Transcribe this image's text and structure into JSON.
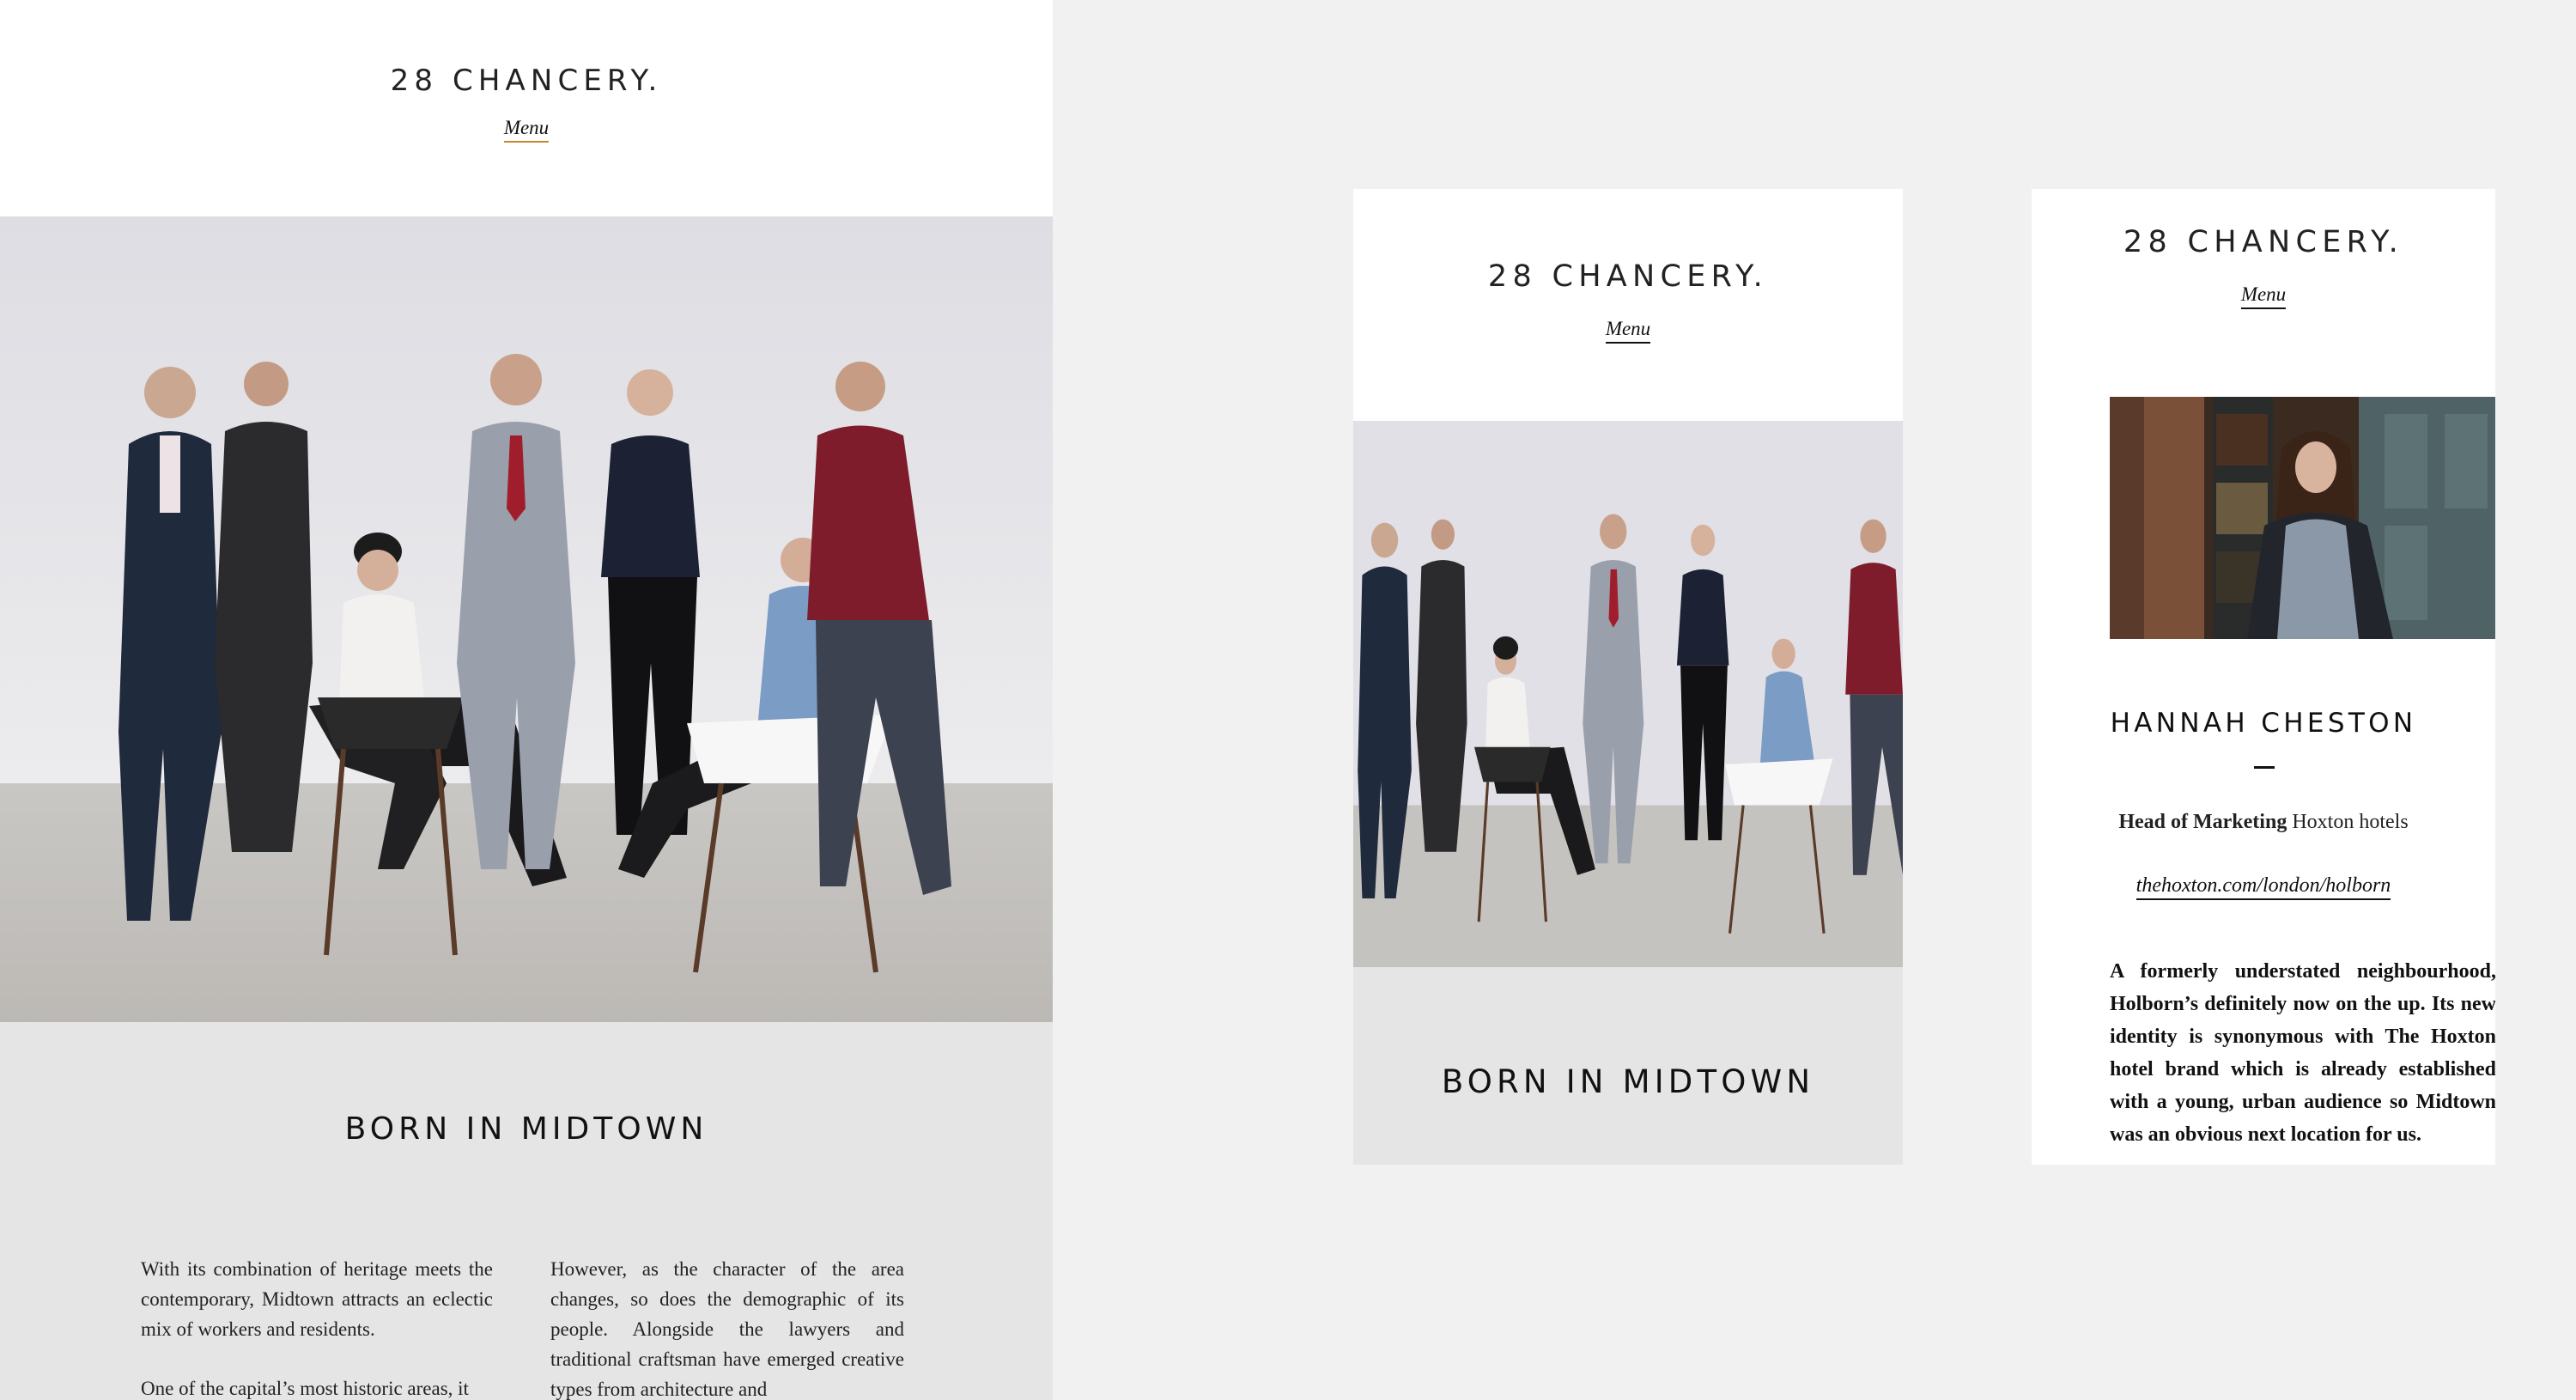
{
  "site": {
    "logo": "28 CHANCERY.",
    "menu_label": "Menu"
  },
  "colors": {
    "page_bg": "#f1f1f1",
    "panel_bg": "#ffffff",
    "article_bg": "#e5e5e5",
    "menu_underline_desktop": "#c8862e",
    "menu_underline_mobile": "#111111"
  },
  "desktop": {
    "heading": "BORN IN MIDTOWN",
    "col1_p1": "With its combination of heritage meets the contemporary, Midtown attracts an eclectic mix of workers and residents.",
    "col1_p2": "One of the capital’s most historic areas, it",
    "col2_p1": "However, as the character of the area changes, so does the demographic of its people. Alongside the lawyers and traditional craftsman have emerged creative types from architecture and"
  },
  "tablet": {
    "heading": "BORN IN MIDTOWN"
  },
  "profile": {
    "name": "HANNAH CHESTON",
    "role_bold": "Head of Marketing",
    "role_company": "Hoxton hotels",
    "link": "thehoxton.com/london/holborn",
    "quote": "A formerly understated neighbourhood, Holborn’s definitely now on the up. Its new identity is synonymous with The Hoxton hotel brand which is already established with a young, urban audience so Midtown was an obvious next location for us."
  }
}
